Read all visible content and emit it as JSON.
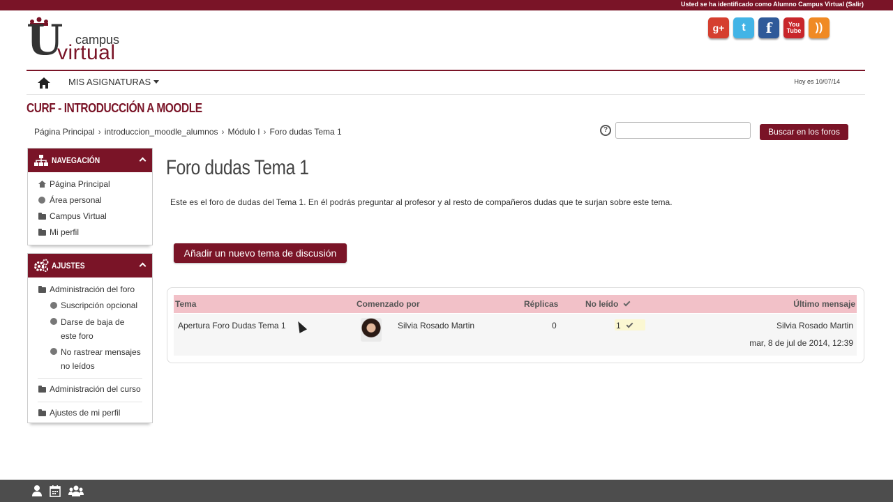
{
  "topbar": {
    "login_text": "Usted se ha identificado como Alumno Campus Virtual (Salir)"
  },
  "logo": {
    "letter": "U",
    "campus": "campus",
    "virtual": "virtual"
  },
  "social": [
    {
      "name": "google-plus",
      "glyph": "g+"
    },
    {
      "name": "twitter",
      "glyph": "t"
    },
    {
      "name": "facebook",
      "glyph": "f"
    },
    {
      "name": "youtube",
      "glyph1": "You",
      "glyph2": "Tube"
    },
    {
      "name": "rss",
      "glyph": "))"
    }
  ],
  "navbar": {
    "menu_label": "MIS ASIGNATURAS",
    "date": "Hoy es 10/07/14"
  },
  "course_title": "CURF - INTRODUCCIÓN A MOODLE",
  "breadcrumb": [
    "Página Principal",
    "introduccion_moodle_alumnos",
    "Módulo I",
    "Foro dudas Tema 1"
  ],
  "breadcrumb_sep": "›",
  "search": {
    "button_label": "Buscar en los foros",
    "placeholder": "",
    "help_glyph": "?"
  },
  "nav_block": {
    "title": "NAVEGACIÓN",
    "items": [
      "Página Principal",
      "Área personal",
      "Campus Virtual",
      "Mi perfil"
    ]
  },
  "settings_block": {
    "title": "AJUSTES",
    "forum_admin": "Administración del foro",
    "forum_admin_items": [
      "Suscripción opcional",
      "Darse de baja de este foro",
      "No rastrear mensajes no leídos"
    ],
    "course_admin": "Administración del curso",
    "profile_settings": "Ajustes de mi perfil"
  },
  "main": {
    "title": "Foro dudas Tema 1",
    "intro": "Este es el foro de dudas del Tema 1. En él podrás preguntar al profesor y al resto de compañeros dudas que te surjan sobre este tema.",
    "add_button": "Añadir un nuevo tema de discusión"
  },
  "table": {
    "headers": {
      "topic": "Tema",
      "started_by": "Comenzado por",
      "replies": "Réplicas",
      "unread": "No leído",
      "last_post": "Último mensaje"
    },
    "rows": [
      {
        "topic": "Apertura Foro Dudas Tema 1",
        "author": "Silvia Rosado Martin",
        "replies": "0",
        "unread": "1",
        "last_author": "Silvia Rosado Martin",
        "last_date": "mar, 8 de jul de 2014, 12:39"
      }
    ]
  },
  "colors": {
    "brand": "#7a1427",
    "table_header": "#f2c1c8",
    "footer": "#4d4d4d"
  }
}
